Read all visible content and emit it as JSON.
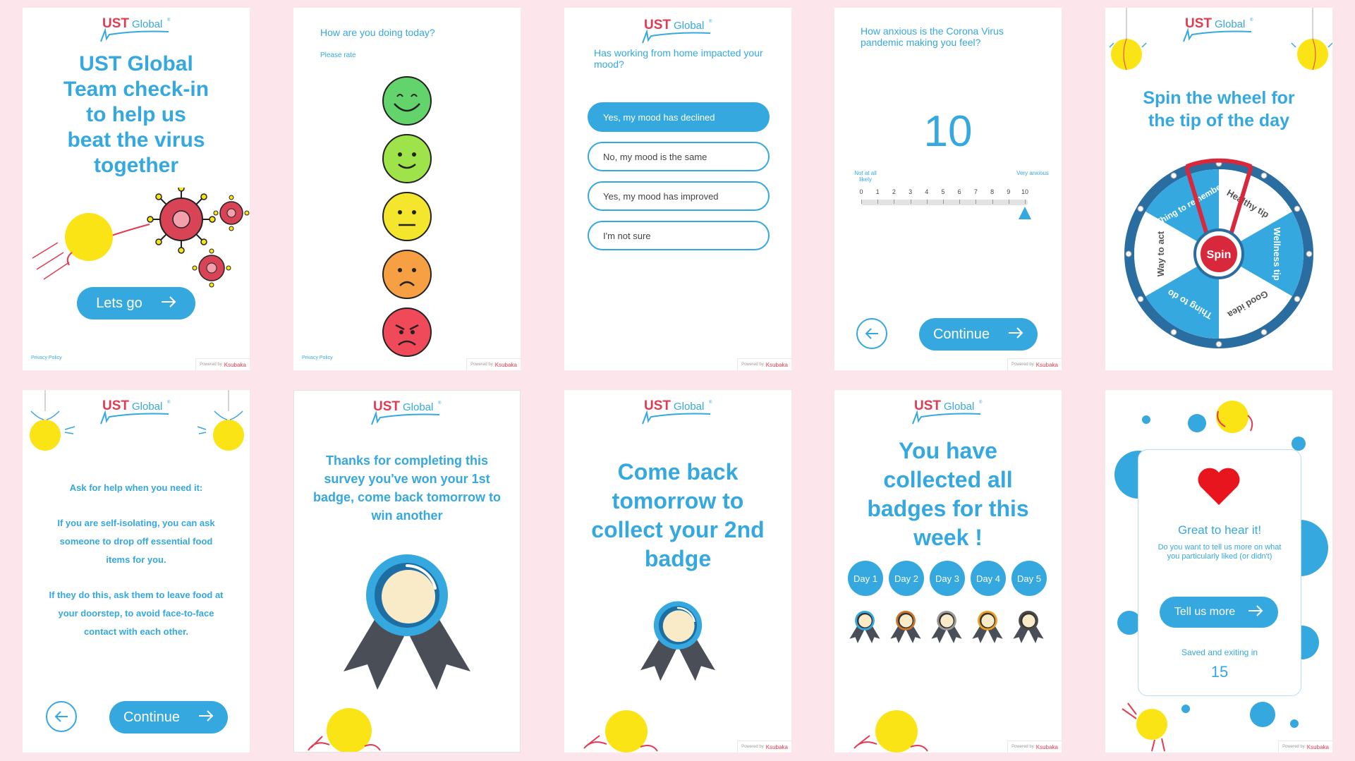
{
  "brand": {
    "ust": "UST",
    "global": "Global",
    "reg": "®"
  },
  "footer": {
    "privacy": "Privacy Policy",
    "powered_by": "Powered by",
    "provider": "Ksubaka"
  },
  "screen1": {
    "title_lines": [
      "UST Global",
      "Team check-in",
      "to help us",
      "beat the virus",
      "together"
    ],
    "button": "Lets go"
  },
  "screen2": {
    "question": "How are you doing today?",
    "subtitle": "Please rate"
  },
  "screen3": {
    "question": "Has working from home impacted your mood?",
    "options": [
      "Yes, my mood has declined",
      "No, my mood is the same",
      "Yes, my mood has improved",
      "I'm not sure"
    ],
    "selected_index": 0
  },
  "screen4": {
    "question": "How anxious is the Corona Virus pandemic making you feel?",
    "value": "10",
    "min_label": "Not at all likely",
    "max_label": "Very anxious",
    "ticks": [
      "0",
      "1",
      "2",
      "3",
      "4",
      "5",
      "6",
      "7",
      "8",
      "9",
      "10"
    ],
    "slider_level": 10,
    "button": "Continue"
  },
  "screen5": {
    "title_lines": [
      "Spin the wheel for",
      "the tip of the day"
    ],
    "segments": [
      "Healthy tip",
      "Wellness tip",
      "Good idea",
      "Thing to do",
      "Way to act",
      "Thing to remember"
    ],
    "spin": "Spin"
  },
  "screen6": {
    "tip": [
      "Ask for help when you need it:",
      "If you are self-isolating, you can ask",
      "someone to drop off essential food",
      "items for you.",
      "If they do this, ask them to leave food at",
      "your doorstep, to avoid face-to-face",
      "contact with each other."
    ],
    "button": "Continue"
  },
  "screen7": {
    "message_lines": [
      "Thanks for completing this",
      "survey you've won your 1st",
      "badge, come back tomorrow to",
      "win another"
    ]
  },
  "screen8": {
    "message_lines": [
      "Come back",
      "tomorrow to",
      "collect your 2nd",
      "badge"
    ]
  },
  "screen9": {
    "title_lines": [
      "You have",
      "collected all",
      "badges for this",
      "week !"
    ],
    "days": [
      "Day 1",
      "Day 2",
      "Day 3",
      "Day 4",
      "Day 5"
    ],
    "badge_colors": [
      "#35a8e0",
      "#c8742a",
      "#9b9b9b",
      "#e8a020",
      "#4a4a4a"
    ]
  },
  "screen10": {
    "heading": "Great to hear it!",
    "prompt": "Do you want to tell us more on what you particularly liked (or didn't)",
    "button": "Tell us more",
    "saving": "Saved and exiting in",
    "countdown": "15"
  },
  "colors": {
    "accent": "#35a8e0",
    "brand_red": "#e23a53",
    "background": "#fce6ec",
    "yellow": "#fbe416"
  }
}
